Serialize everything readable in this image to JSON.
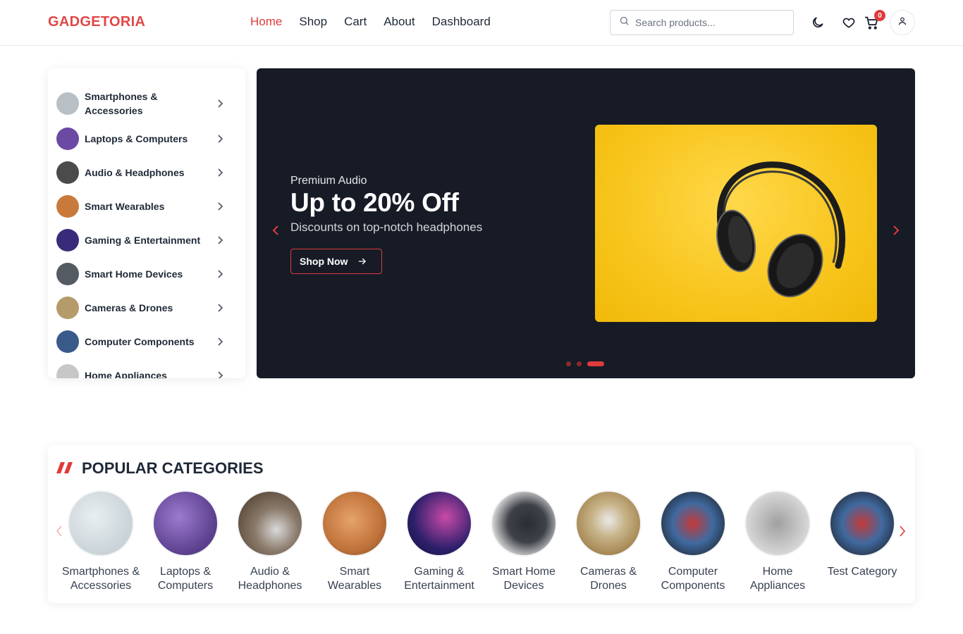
{
  "header": {
    "logo": "GADGETORIA",
    "nav": [
      {
        "label": "Home",
        "active": true
      },
      {
        "label": "Shop",
        "active": false
      },
      {
        "label": "Cart",
        "active": false
      },
      {
        "label": "About",
        "active": false
      },
      {
        "label": "Dashboard",
        "active": false
      }
    ],
    "search_placeholder": "Search products...",
    "cart_count": "0"
  },
  "sidebar": {
    "items": [
      {
        "label": "Smartphones & Accessories",
        "thumb": "#b8c0c6"
      },
      {
        "label": "Laptops & Computers",
        "thumb": "#6b4aa3"
      },
      {
        "label": "Audio & Headphones",
        "thumb": "#4b4b4b"
      },
      {
        "label": "Smart Wearables",
        "thumb": "#c97a3a"
      },
      {
        "label": "Gaming & Entertainment",
        "thumb": "#3a2a7a"
      },
      {
        "label": "Smart Home Devices",
        "thumb": "#555b63"
      },
      {
        "label": "Cameras & Drones",
        "thumb": "#b59a6a"
      },
      {
        "label": "Computer Components",
        "thumb": "#3a5a8a"
      },
      {
        "label": "Home Appliances",
        "thumb": "#c7c7c7"
      }
    ]
  },
  "banner": {
    "kicker": "Premium Audio",
    "headline": "Up to 20% Off",
    "subline": "Discounts on top-notch headphones",
    "cta": "Shop Now",
    "active_slide": 3,
    "slide_count": 3
  },
  "popular": {
    "title": "POPULAR CATEGORIES",
    "items": [
      {
        "label": "Smartphones & Accessories",
        "color": "#c9d3d8"
      },
      {
        "label": "Laptops & Computers",
        "color": "#5a3f8c"
      },
      {
        "label": "Audio & Headphones",
        "color": "#5b4a3a"
      },
      {
        "label": "Smart Wearables",
        "color": "#c0733a"
      },
      {
        "label": "Gaming & Entertainment",
        "color": "#2d1f6b"
      },
      {
        "label": "Smart Home Devices",
        "color": "#3d4148"
      },
      {
        "label": "Cameras & Drones",
        "color": "#a88a56"
      },
      {
        "label": "Computer Components",
        "color": "#3f6aa0"
      },
      {
        "label": "Home Appliances",
        "color": "#cfcfcf"
      },
      {
        "label": "Test Category",
        "color": "#3f6aa0"
      }
    ]
  },
  "colors": {
    "accent": "#e03b3b",
    "banner_bg": "#161b26",
    "hero_yellow": "#f7c51c"
  }
}
